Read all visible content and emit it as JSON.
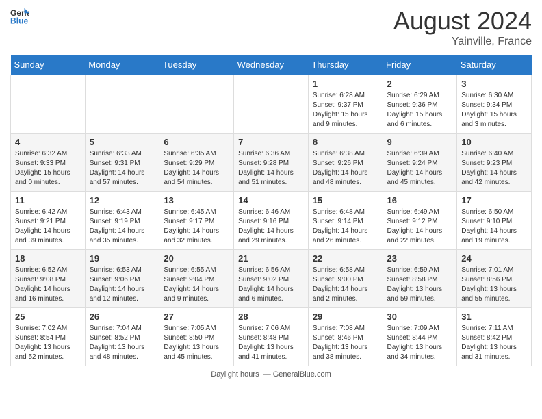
{
  "header": {
    "logo_line1": "General",
    "logo_line2": "Blue",
    "month_title": "August 2024",
    "location": "Yainville, France"
  },
  "days_of_week": [
    "Sunday",
    "Monday",
    "Tuesday",
    "Wednesday",
    "Thursday",
    "Friday",
    "Saturday"
  ],
  "weeks": [
    [
      {
        "day": "",
        "info": ""
      },
      {
        "day": "",
        "info": ""
      },
      {
        "day": "",
        "info": ""
      },
      {
        "day": "",
        "info": ""
      },
      {
        "day": "1",
        "info": "Sunrise: 6:28 AM\nSunset: 9:37 PM\nDaylight: 15 hours and 9 minutes."
      },
      {
        "day": "2",
        "info": "Sunrise: 6:29 AM\nSunset: 9:36 PM\nDaylight: 15 hours and 6 minutes."
      },
      {
        "day": "3",
        "info": "Sunrise: 6:30 AM\nSunset: 9:34 PM\nDaylight: 15 hours and 3 minutes."
      }
    ],
    [
      {
        "day": "4",
        "info": "Sunrise: 6:32 AM\nSunset: 9:33 PM\nDaylight: 15 hours and 0 minutes."
      },
      {
        "day": "5",
        "info": "Sunrise: 6:33 AM\nSunset: 9:31 PM\nDaylight: 14 hours and 57 minutes."
      },
      {
        "day": "6",
        "info": "Sunrise: 6:35 AM\nSunset: 9:29 PM\nDaylight: 14 hours and 54 minutes."
      },
      {
        "day": "7",
        "info": "Sunrise: 6:36 AM\nSunset: 9:28 PM\nDaylight: 14 hours and 51 minutes."
      },
      {
        "day": "8",
        "info": "Sunrise: 6:38 AM\nSunset: 9:26 PM\nDaylight: 14 hours and 48 minutes."
      },
      {
        "day": "9",
        "info": "Sunrise: 6:39 AM\nSunset: 9:24 PM\nDaylight: 14 hours and 45 minutes."
      },
      {
        "day": "10",
        "info": "Sunrise: 6:40 AM\nSunset: 9:23 PM\nDaylight: 14 hours and 42 minutes."
      }
    ],
    [
      {
        "day": "11",
        "info": "Sunrise: 6:42 AM\nSunset: 9:21 PM\nDaylight: 14 hours and 39 minutes."
      },
      {
        "day": "12",
        "info": "Sunrise: 6:43 AM\nSunset: 9:19 PM\nDaylight: 14 hours and 35 minutes."
      },
      {
        "day": "13",
        "info": "Sunrise: 6:45 AM\nSunset: 9:17 PM\nDaylight: 14 hours and 32 minutes."
      },
      {
        "day": "14",
        "info": "Sunrise: 6:46 AM\nSunset: 9:16 PM\nDaylight: 14 hours and 29 minutes."
      },
      {
        "day": "15",
        "info": "Sunrise: 6:48 AM\nSunset: 9:14 PM\nDaylight: 14 hours and 26 minutes."
      },
      {
        "day": "16",
        "info": "Sunrise: 6:49 AM\nSunset: 9:12 PM\nDaylight: 14 hours and 22 minutes."
      },
      {
        "day": "17",
        "info": "Sunrise: 6:50 AM\nSunset: 9:10 PM\nDaylight: 14 hours and 19 minutes."
      }
    ],
    [
      {
        "day": "18",
        "info": "Sunrise: 6:52 AM\nSunset: 9:08 PM\nDaylight: 14 hours and 16 minutes."
      },
      {
        "day": "19",
        "info": "Sunrise: 6:53 AM\nSunset: 9:06 PM\nDaylight: 14 hours and 12 minutes."
      },
      {
        "day": "20",
        "info": "Sunrise: 6:55 AM\nSunset: 9:04 PM\nDaylight: 14 hours and 9 minutes."
      },
      {
        "day": "21",
        "info": "Sunrise: 6:56 AM\nSunset: 9:02 PM\nDaylight: 14 hours and 6 minutes."
      },
      {
        "day": "22",
        "info": "Sunrise: 6:58 AM\nSunset: 9:00 PM\nDaylight: 14 hours and 2 minutes."
      },
      {
        "day": "23",
        "info": "Sunrise: 6:59 AM\nSunset: 8:58 PM\nDaylight: 13 hours and 59 minutes."
      },
      {
        "day": "24",
        "info": "Sunrise: 7:01 AM\nSunset: 8:56 PM\nDaylight: 13 hours and 55 minutes."
      }
    ],
    [
      {
        "day": "25",
        "info": "Sunrise: 7:02 AM\nSunset: 8:54 PM\nDaylight: 13 hours and 52 minutes."
      },
      {
        "day": "26",
        "info": "Sunrise: 7:04 AM\nSunset: 8:52 PM\nDaylight: 13 hours and 48 minutes."
      },
      {
        "day": "27",
        "info": "Sunrise: 7:05 AM\nSunset: 8:50 PM\nDaylight: 13 hours and 45 minutes."
      },
      {
        "day": "28",
        "info": "Sunrise: 7:06 AM\nSunset: 8:48 PM\nDaylight: 13 hours and 41 minutes."
      },
      {
        "day": "29",
        "info": "Sunrise: 7:08 AM\nSunset: 8:46 PM\nDaylight: 13 hours and 38 minutes."
      },
      {
        "day": "30",
        "info": "Sunrise: 7:09 AM\nSunset: 8:44 PM\nDaylight: 13 hours and 34 minutes."
      },
      {
        "day": "31",
        "info": "Sunrise: 7:11 AM\nSunset: 8:42 PM\nDaylight: 13 hours and 31 minutes."
      }
    ]
  ],
  "footer": {
    "daylight_label": "Daylight hours"
  }
}
